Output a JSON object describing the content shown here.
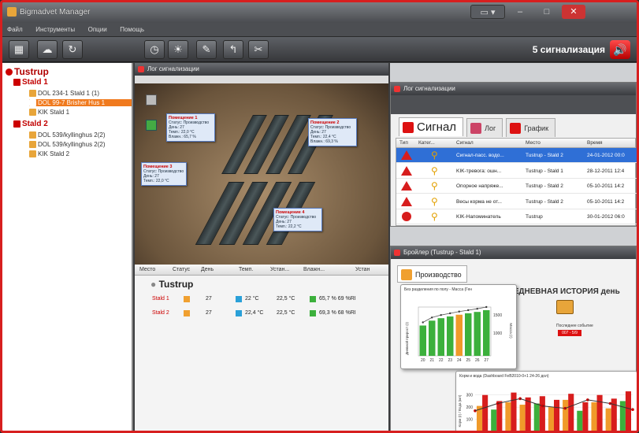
{
  "window": {
    "title": "Bigmadvet Manager"
  },
  "menu": [
    "Файл",
    "Инструменты",
    "Опции",
    "Помощь"
  ],
  "toolbar": {
    "left_icons": [
      "grid-icon",
      "cloud-icon",
      "refresh-icon"
    ],
    "mid_icons": [
      "clock-icon",
      "sun-icon",
      "edit-icon",
      "arrow-icon",
      "tool-icon"
    ],
    "alarm_text": "5 сигнализация",
    "alarm_icon": "speaker-icon"
  },
  "tree": {
    "farm": "Tustrup",
    "stalds": [
      {
        "name": "Stald 1",
        "items": [
          {
            "label": "DOL 234-1 Stald 1",
            "badge": "(1)",
            "selected": false
          },
          {
            "label": "DOL 99-7 Brisher Hus 1",
            "badge": "",
            "selected": true
          },
          {
            "label": "KIK Stald 1",
            "badge": "",
            "selected": false
          }
        ]
      },
      {
        "name": "Stald 2",
        "items": [
          {
            "label": "DOL 539/kyllinghus 2(2)",
            "badge": "",
            "selected": false
          },
          {
            "label": "DOL 539/kyllinghus 2(2)",
            "badge": "",
            "selected": false
          },
          {
            "label": "KIK Stald 2",
            "badge": "",
            "selected": false
          }
        ]
      }
    ]
  },
  "center": {
    "pane_title": "Лог сигнализации",
    "tags": [
      {
        "title": "Помещение 1",
        "lines": [
          "Статус: Производство",
          "День: 27",
          "Темп.: 22,0 °C",
          "Влажн.: 65,7 %"
        ]
      },
      {
        "title": "Помещение 2",
        "lines": [
          "Статус: Производство",
          "День: 27",
          "Темп.: 22,4 °C",
          "Влажн.: 69,3 %"
        ]
      },
      {
        "title": "Помещение 3",
        "lines": [
          "Статус: Производство",
          "День: 27",
          "Темп.: 22,0 °C"
        ]
      },
      {
        "title": "Помещение 4",
        "lines": [
          "Статус: Производство",
          "День: 27",
          "Темп.: 22,2 °C"
        ]
      }
    ],
    "table": {
      "headers": [
        "Место",
        "Статус",
        "День",
        "Темп.",
        "Устан...",
        "Влажн...",
        "Устан"
      ],
      "farm": "Tustrup",
      "rows": [
        {
          "name": "Stald 1",
          "day": "27",
          "temp": "22 °C",
          "set": "22,5 °C",
          "hum": "65,7 % 69 %RI"
        },
        {
          "name": "Stald 2",
          "day": "27",
          "temp": "22,4 °C",
          "set": "22,5 °C",
          "hum": "69,3 % 68 %RI"
        }
      ]
    }
  },
  "alarm_log": {
    "title": "Лог сигнализации",
    "tabs": [
      "Сигнал",
      "Лог",
      "График"
    ],
    "headers": [
      "Тип",
      "Катег...",
      "Сигнал",
      "Место",
      "Время"
    ],
    "rows": [
      {
        "signal": "Сигнал-пасс. водо...",
        "place": "Tustrup - Stald 2",
        "time": "24-01-2012 00:0",
        "type": "triangle",
        "selected": true
      },
      {
        "signal": "KIK-тревога: ошн...",
        "place": "Tustrup - Stald 1",
        "time": "28-12-2011 12:4",
        "type": "triangle",
        "selected": false
      },
      {
        "signal": "Опорное напряже...",
        "place": "Tustrup - Stald 2",
        "time": "05-10-2011 14:2",
        "type": "triangle",
        "selected": false
      },
      {
        "signal": "Весы корма не от...",
        "place": "Tustrup - Stald 2",
        "time": "05-10-2011 14:2",
        "type": "triangle",
        "selected": false
      },
      {
        "signal": "KIK-Напоминатель",
        "place": "Tustrup",
        "time": "30-01-2012 06:0",
        "type": "circle",
        "selected": false
      }
    ]
  },
  "production": {
    "title": "Бройлер (Tustrup - Stald 1)",
    "tab": "Производство",
    "daily_title": "ЕЖЕДНЕВНАЯ ИСТОРИЯ день",
    "daily_note": "Последнее событие",
    "daily_value": "007 - 5/9",
    "chart1_title": "Без разделения по полу - Масса (Ген",
    "chart2_title": "Корм и вода (Dashboard FeB2010-0+1 24-26 дол)"
  },
  "chart_data": [
    {
      "type": "bar",
      "title": "Без разделения по полу - Масса (Ген",
      "categories": [
        "20",
        "21",
        "22",
        "23",
        "24",
        "25",
        "26",
        "27"
      ],
      "series": [
        {
          "name": "",
          "values": [
            870,
            1010,
            1080,
            1130,
            1180,
            1220,
            1260,
            1310
          ]
        }
      ],
      "xlabel": "",
      "ylabel": "Дневной прирост (г)",
      "y2label": "Масса (г)",
      "y2ticks": [
        "1000",
        "1500"
      ],
      "bar_colors": [
        "#3cb03c",
        "#3cb03c",
        "#3cb03c",
        "#3cb03c",
        "#f09a2a",
        "#3cb03c",
        "#3cb03c",
        "#3cb03c"
      ]
    },
    {
      "type": "bar",
      "title": "Корм и вода (Dashboard FeB2010-0+1 24-26 дол)",
      "categories": [
        "1",
        "2",
        "3",
        "4",
        "5",
        "6",
        "7",
        "8",
        "9",
        "10",
        "11"
      ],
      "yticks": [
        "100",
        "200",
        "300"
      ],
      "ylabel": "Корм (г) / Вода (мл)",
      "series": [
        {
          "name": "",
          "values": [
            210,
            180,
            240,
            220,
            230,
            200,
            260,
            170,
            240,
            190,
            250
          ]
        },
        {
          "name": "",
          "values": [
            300,
            250,
            320,
            280,
            290,
            260,
            310,
            240,
            300,
            270,
            330
          ]
        }
      ],
      "line": [
        170,
        230,
        270,
        210,
        190,
        260,
        230,
        180
      ]
    }
  ]
}
